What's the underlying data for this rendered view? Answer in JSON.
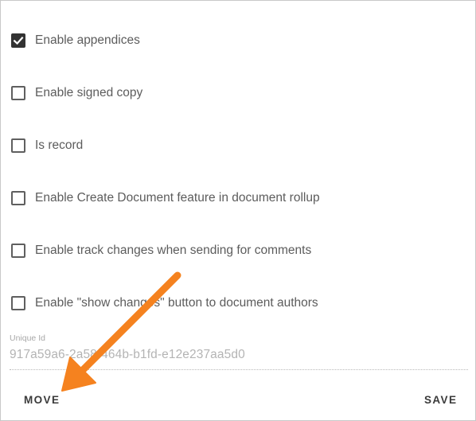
{
  "checkboxes": [
    {
      "label": "Enable appendices",
      "checked": true
    },
    {
      "label": "Enable signed copy",
      "checked": false
    },
    {
      "label": "Is record",
      "checked": false
    },
    {
      "label": "Enable Create Document feature in document rollup",
      "checked": false
    },
    {
      "label": "Enable track changes when sending for comments",
      "checked": false
    },
    {
      "label": "Enable \"show changes\" button to document authors",
      "checked": false
    }
  ],
  "unique_id": {
    "label": "Unique Id",
    "value": "917a59a6-2a58-464b-b1fd-e12e237aa5d0"
  },
  "actions": {
    "move_label": "MOVE",
    "save_label": "SAVE"
  },
  "colors": {
    "annotation_arrow": "#F5821F",
    "checkbox_checked": "#333333"
  },
  "icons": {
    "checkmark": "check-icon",
    "annotation": "arrow-annotation-icon"
  }
}
